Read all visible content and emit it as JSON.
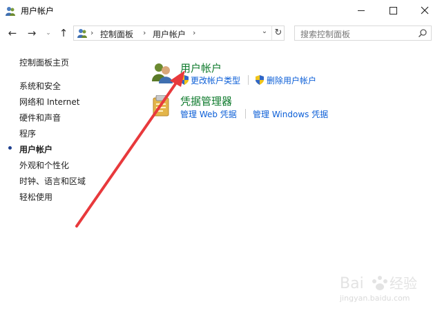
{
  "window": {
    "title": "用户帐户",
    "minimize_label": "—",
    "maximize_label": "☐",
    "close_label": "✕"
  },
  "nav": {
    "back": "←",
    "forward": "→",
    "recent": "⌄",
    "up": "↑",
    "breadcrumb": [
      "控制面板",
      "用户帐户"
    ],
    "refresh": "↻",
    "search_placeholder": "搜索控制面板"
  },
  "sidebar": {
    "items": [
      {
        "label": "控制面板主页"
      },
      {
        "label": "系统和安全"
      },
      {
        "label": "网络和 Internet"
      },
      {
        "label": "硬件和声音"
      },
      {
        "label": "程序"
      },
      {
        "label": "用户帐户",
        "active": true
      },
      {
        "label": "外观和个性化"
      },
      {
        "label": "时钟、语言和区域"
      },
      {
        "label": "轻松使用"
      }
    ]
  },
  "main": {
    "categories": [
      {
        "title": "用户帐户",
        "icon": "users-icon",
        "links": [
          "更改帐户类型",
          "删除用户帐户"
        ]
      },
      {
        "title": "凭据管理器",
        "icon": "credential-manager-icon",
        "links": [
          "管理 Web 凭据",
          "管理 Windows 凭据"
        ]
      }
    ]
  },
  "colors": {
    "category_title": "#0e7a2c",
    "link": "#0b5ed7",
    "annotation_arrow": "#e8393c"
  },
  "watermark": {
    "text": "jingyan.baidu.com"
  }
}
